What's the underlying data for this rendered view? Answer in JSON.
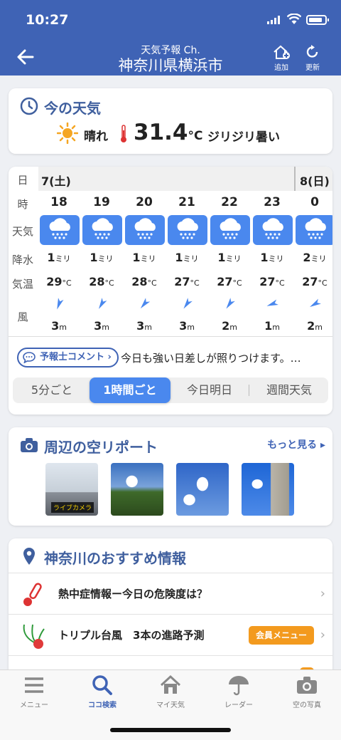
{
  "status": {
    "time": "10:27"
  },
  "header": {
    "subtitle": "天気予報 Ch.",
    "title": "神奈川県横浜市",
    "add_label": "追加",
    "refresh_label": "更新"
  },
  "now": {
    "title": "今の天気",
    "condition": "晴れ",
    "temp": "31.4",
    "unit": "°C",
    "feel": "ジリジリ暑い"
  },
  "forecast": {
    "row_labels": [
      "日",
      "時",
      "天気",
      "降水",
      "気温",
      "風"
    ],
    "day1": "7(土)",
    "day2": "8(日)",
    "precip_unit": "ミリ",
    "temp_unit": "°C",
    "wind_unit": "m",
    "hours": [
      {
        "hour": "18",
        "precip": "1",
        "temp": "29",
        "wind": "3",
        "dir": 200
      },
      {
        "hour": "19",
        "precip": "1",
        "temp": "28",
        "wind": "3",
        "dir": 210
      },
      {
        "hour": "20",
        "precip": "1",
        "temp": "28",
        "wind": "3",
        "dir": 220
      },
      {
        "hour": "21",
        "precip": "1",
        "temp": "27",
        "wind": "3",
        "dir": 215
      },
      {
        "hour": "22",
        "precip": "1",
        "temp": "27",
        "wind": "2",
        "dir": 215
      },
      {
        "hour": "23",
        "precip": "1",
        "temp": "27",
        "wind": "1",
        "dir": 250
      },
      {
        "hour": "0",
        "precip": "2",
        "temp": "27",
        "wind": "2",
        "dir": 240
      }
    ],
    "comment_label": "予報士コメント",
    "comment_text": "今日も強い日差しが照りつけます。…",
    "segments": [
      "5分ごと",
      "1時間ごと",
      "今日明日",
      "週間天気"
    ]
  },
  "sky": {
    "title": "周辺の空リポート",
    "more": "もっと見る",
    "live_label": "ライブカメラ"
  },
  "rec": {
    "title": "神奈川のおすすめ情報",
    "items": [
      {
        "text": "熱中症情報ー今日の危険度は？"
      },
      {
        "text": "トリプル台風　3本の進路予測",
        "badge": "会員メニュー"
      },
      {
        "text": "",
        "badge": ""
      }
    ]
  },
  "tabs": [
    "メニュー",
    "ココ検索",
    "マイ天気",
    "レーダー",
    "空の写真"
  ],
  "colors": {
    "header": "#3f63b5",
    "accent": "#4a88ee",
    "badge": "#f39a1e"
  }
}
